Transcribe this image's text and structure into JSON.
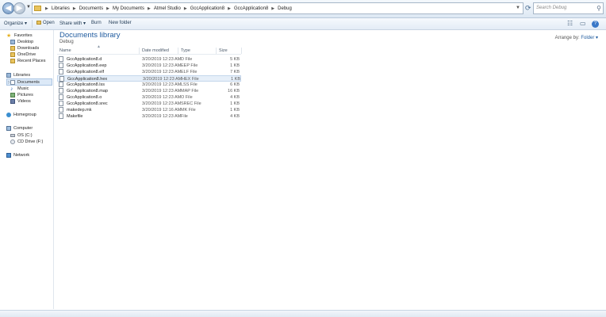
{
  "address_bar": {
    "crumbs": [
      "Libraries",
      "Documents",
      "My Documents",
      "Atmel Studio",
      "GccApplication8",
      "GccApplication8",
      "Debug"
    ],
    "search_placeholder": "Search Debug"
  },
  "toolbar": {
    "organize": "Organize ▾",
    "open": "Open",
    "share_with": "Share with ▾",
    "burn": "Burn",
    "new_folder": "New folder"
  },
  "nav": {
    "favorites": "Favorites",
    "desktop": "Desktop",
    "downloads": "Downloads",
    "onedrive": "OneDrive",
    "recent_places": "Recent Places",
    "libraries": "Libraries",
    "documents": "Documents",
    "music": "Music",
    "pictures": "Pictures",
    "videos": "Videos",
    "homegroup": "Homegroup",
    "computer": "Computer",
    "os_c": "OS (C:)",
    "cd_drive": "CD Drive (F:)",
    "network": "Network"
  },
  "content": {
    "title": "Documents library",
    "subtitle": "Debug",
    "arrange_by_label": "Arrange by:",
    "arrange_by_value": "Folder ▾",
    "columns": {
      "name": "Name",
      "date": "Date modified",
      "type": "Type",
      "size": "Size"
    },
    "files": [
      {
        "name": "GccApplication8.d",
        "date": "3/20/2019 12:23 AM",
        "type": "D File",
        "size": "5 KB"
      },
      {
        "name": "GccApplication8.eep",
        "date": "3/20/2019 12:23 AM",
        "type": "EEP File",
        "size": "1 KB"
      },
      {
        "name": "GccApplication8.elf",
        "date": "3/20/2019 12:23 AM",
        "type": "ELF File",
        "size": "7 KB"
      },
      {
        "name": "GccApplication8.hex",
        "date": "3/20/2019 12:23 AM",
        "type": "HEX File",
        "size": "1 KB"
      },
      {
        "name": "GccApplication8.lss",
        "date": "3/20/2019 12:23 AM",
        "type": "LSS File",
        "size": "6 KB"
      },
      {
        "name": "GccApplication8.map",
        "date": "3/20/2019 12:23 AM",
        "type": "MAP File",
        "size": "16 KB"
      },
      {
        "name": "GccApplication8.o",
        "date": "3/20/2019 12:23 AM",
        "type": "O File",
        "size": "4 KB"
      },
      {
        "name": "GccApplication8.srec",
        "date": "3/20/2019 12:23 AM",
        "type": "SREC File",
        "size": "1 KB"
      },
      {
        "name": "makedep.mk",
        "date": "3/20/2019 12:16 AM",
        "type": "MK File",
        "size": "1 KB"
      },
      {
        "name": "Makefile",
        "date": "3/20/2019 12:23 AM",
        "type": "File",
        "size": "4 KB"
      }
    ],
    "selected_index": 3
  }
}
